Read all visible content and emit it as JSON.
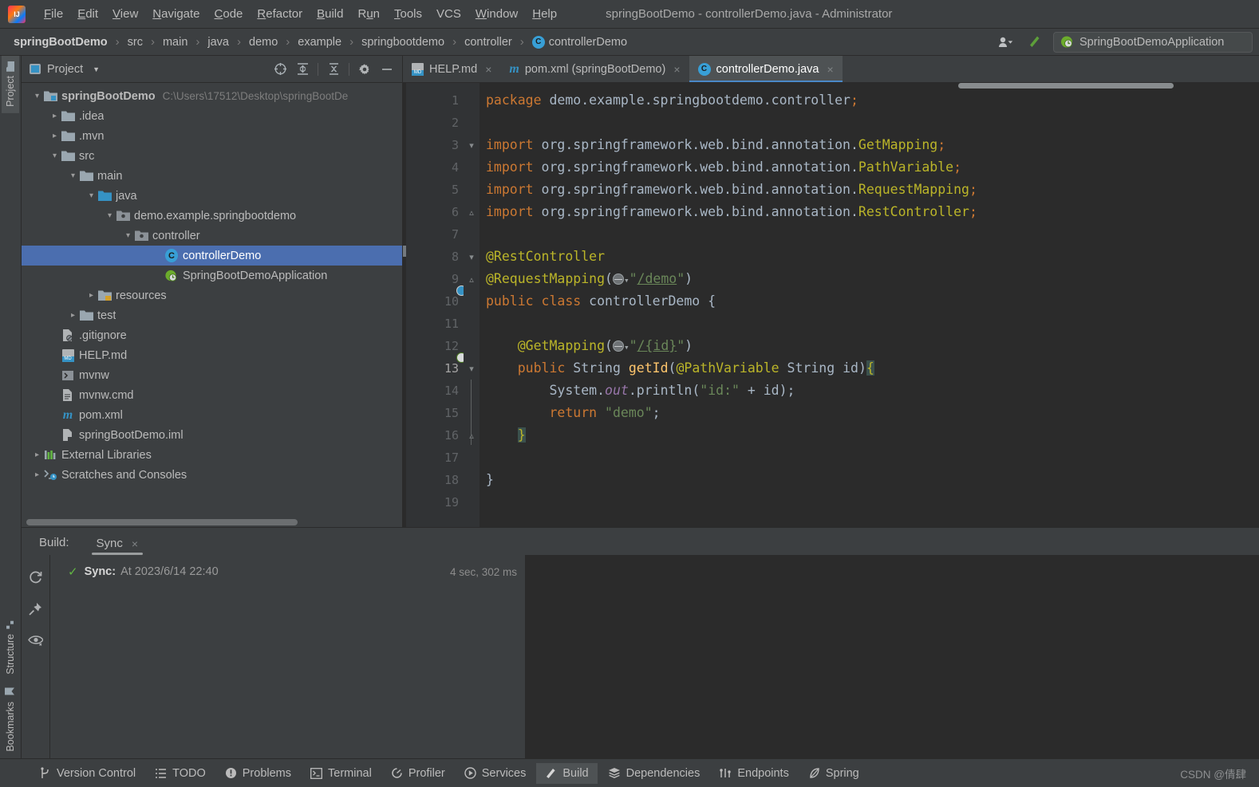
{
  "window": {
    "title": "springBootDemo - controllerDemo.java - Administrator"
  },
  "menubar": {
    "items": [
      {
        "label": "File",
        "mnemonic": "F"
      },
      {
        "label": "Edit",
        "mnemonic": "E"
      },
      {
        "label": "View",
        "mnemonic": "V"
      },
      {
        "label": "Navigate",
        "mnemonic": "N"
      },
      {
        "label": "Code",
        "mnemonic": "C"
      },
      {
        "label": "Refactor",
        "mnemonic": "R"
      },
      {
        "label": "Build",
        "mnemonic": "B"
      },
      {
        "label": "Run",
        "mnemonic": "u"
      },
      {
        "label": "Tools",
        "mnemonic": "T"
      },
      {
        "label": "VCS",
        "mnemonic": ""
      },
      {
        "label": "Window",
        "mnemonic": "W"
      },
      {
        "label": "Help",
        "mnemonic": "H"
      }
    ]
  },
  "navbar": {
    "crumbs": [
      "springBootDemo",
      "src",
      "main",
      "java",
      "demo",
      "example",
      "springbootdemo",
      "controller",
      "controllerDemo"
    ],
    "separator": "›",
    "run_config": "SpringBootDemoApplication",
    "class_badge": "C"
  },
  "tool_strip": {
    "top": [
      {
        "label": "Project",
        "icon": "folder-icon"
      }
    ],
    "bottom": [
      {
        "label": "Structure",
        "icon": "structure-icon"
      },
      {
        "label": "Bookmarks",
        "icon": "bookmark-icon"
      }
    ]
  },
  "project_panel": {
    "title": "Project",
    "tree": [
      {
        "indent": 0,
        "arrow": "down",
        "icon": "module-folder-icon",
        "label": "springBootDemo",
        "bold": true,
        "path": "C:\\Users\\17512\\Desktop\\springBootDe"
      },
      {
        "indent": 1,
        "arrow": "right",
        "icon": "folder-icon",
        "label": ".idea"
      },
      {
        "indent": 1,
        "arrow": "right",
        "icon": "folder-icon",
        "label": ".mvn"
      },
      {
        "indent": 1,
        "arrow": "down",
        "icon": "folder-icon",
        "label": "src"
      },
      {
        "indent": 2,
        "arrow": "down",
        "icon": "folder-icon",
        "label": "main"
      },
      {
        "indent": 3,
        "arrow": "down",
        "icon": "source-folder-icon",
        "label": "java"
      },
      {
        "indent": 4,
        "arrow": "down",
        "icon": "package-icon",
        "label": "demo.example.springbootdemo"
      },
      {
        "indent": 5,
        "arrow": "down",
        "icon": "package-icon",
        "label": "controller"
      },
      {
        "indent": 6,
        "arrow": "none",
        "icon": "java-class-icon",
        "label": "controllerDemo",
        "selected": true
      },
      {
        "indent": 5,
        "arrow": "none",
        "icon": "spring-boot-icon",
        "label": "SpringBootDemoApplication"
      },
      {
        "indent": 3,
        "arrow": "right",
        "icon": "resources-folder-icon",
        "label": "resources"
      },
      {
        "indent": 2,
        "arrow": "right",
        "icon": "folder-icon",
        "label": "test"
      },
      {
        "indent": 1,
        "arrow": "none",
        "icon": "gitignore-icon",
        "label": ".gitignore"
      },
      {
        "indent": 1,
        "arrow": "none",
        "icon": "markdown-icon",
        "label": "HELP.md"
      },
      {
        "indent": 1,
        "arrow": "none",
        "icon": "shell-script-icon",
        "label": "mvnw"
      },
      {
        "indent": 1,
        "arrow": "none",
        "icon": "text-file-icon",
        "label": "mvnw.cmd"
      },
      {
        "indent": 1,
        "arrow": "none",
        "icon": "maven-icon",
        "label": "pom.xml"
      },
      {
        "indent": 1,
        "arrow": "none",
        "icon": "iml-file-icon",
        "label": "springBootDemo.iml"
      },
      {
        "indent": 0,
        "arrow": "right",
        "icon": "libraries-icon",
        "label": "External Libraries"
      },
      {
        "indent": 0,
        "arrow": "right",
        "icon": "scratches-icon",
        "label": "Scratches and Consoles"
      }
    ]
  },
  "editor": {
    "tabs": [
      {
        "label": "HELP.md",
        "icon": "markdown-icon",
        "active": false
      },
      {
        "label": "pom.xml (springBootDemo)",
        "icon": "maven-icon",
        "active": false
      },
      {
        "label": "controllerDemo.java",
        "icon": "java-class-icon",
        "active": true
      }
    ],
    "lines": [
      {
        "n": 1,
        "text": "package demo.example.springbootdemo.controller;"
      },
      {
        "n": 2,
        "text": ""
      },
      {
        "n": 3,
        "text": "import org.springframework.web.bind.annotation.GetMapping;"
      },
      {
        "n": 4,
        "text": "import org.springframework.web.bind.annotation.PathVariable;"
      },
      {
        "n": 5,
        "text": "import org.springframework.web.bind.annotation.RequestMapping;"
      },
      {
        "n": 6,
        "text": "import org.springframework.web.bind.annotation.RestController;"
      },
      {
        "n": 7,
        "text": ""
      },
      {
        "n": 8,
        "text": "@RestController"
      },
      {
        "n": 9,
        "text": "@RequestMapping(\"/demo\")"
      },
      {
        "n": 10,
        "text": "public class controllerDemo {"
      },
      {
        "n": 11,
        "text": ""
      },
      {
        "n": 12,
        "text": "    @GetMapping(\"/{id}\")"
      },
      {
        "n": 13,
        "text": "    public String getId(@PathVariable String id){"
      },
      {
        "n": 14,
        "text": "        System.out.println(\"id:\" + id);"
      },
      {
        "n": 15,
        "text": "        return \"demo\";"
      },
      {
        "n": 16,
        "text": "    }"
      },
      {
        "n": 17,
        "text": ""
      },
      {
        "n": 18,
        "text": "}"
      },
      {
        "n": 19,
        "text": ""
      }
    ],
    "current_line": 13,
    "gutter_icons": [
      {
        "line": 10,
        "icon": "spring-bean-icon"
      },
      {
        "line": 13,
        "icon": "spring-endpoint-icon"
      }
    ]
  },
  "build": {
    "label": "Build:",
    "tab": "Sync",
    "close": "×",
    "rows": [
      {
        "status_icon": "checkmark-icon",
        "title": "Sync:",
        "text": "At 2023/6/14 22:40",
        "duration": "4 sec, 302 ms"
      }
    ],
    "side_icons": [
      "refresh-icon",
      "pin-icon",
      "eye-icon"
    ]
  },
  "statusbar": {
    "items": [
      {
        "label": "Version Control",
        "icon": "branch-icon",
        "active": false
      },
      {
        "label": "TODO",
        "icon": "todo-list-icon",
        "active": false
      },
      {
        "label": "Problems",
        "icon": "warning-icon",
        "active": false
      },
      {
        "label": "Terminal",
        "icon": "terminal-icon",
        "active": false
      },
      {
        "label": "Profiler",
        "icon": "profiler-icon",
        "active": false
      },
      {
        "label": "Services",
        "icon": "services-icon",
        "active": false
      },
      {
        "label": "Build",
        "icon": "hammer-icon",
        "active": true
      },
      {
        "label": "Dependencies",
        "icon": "layers-icon",
        "active": false
      },
      {
        "label": "Endpoints",
        "icon": "endpoints-icon",
        "active": false
      },
      {
        "label": "Spring",
        "icon": "spring-leaf-icon",
        "active": false
      }
    ],
    "watermark": "CSDN @倩肆"
  },
  "colors": {
    "panel_bg": "#3c3f41",
    "editor_bg": "#2b2b2b",
    "gutter_bg": "#313335",
    "selection": "#4b6eaf",
    "accent": "#3592c4",
    "keyword": "#cc7832",
    "annotation": "#bbb529",
    "string": "#6a8759",
    "method": "#ffc66d",
    "static_field": "#9876aa",
    "text": "#a9b7c6",
    "success": "#62b543"
  }
}
